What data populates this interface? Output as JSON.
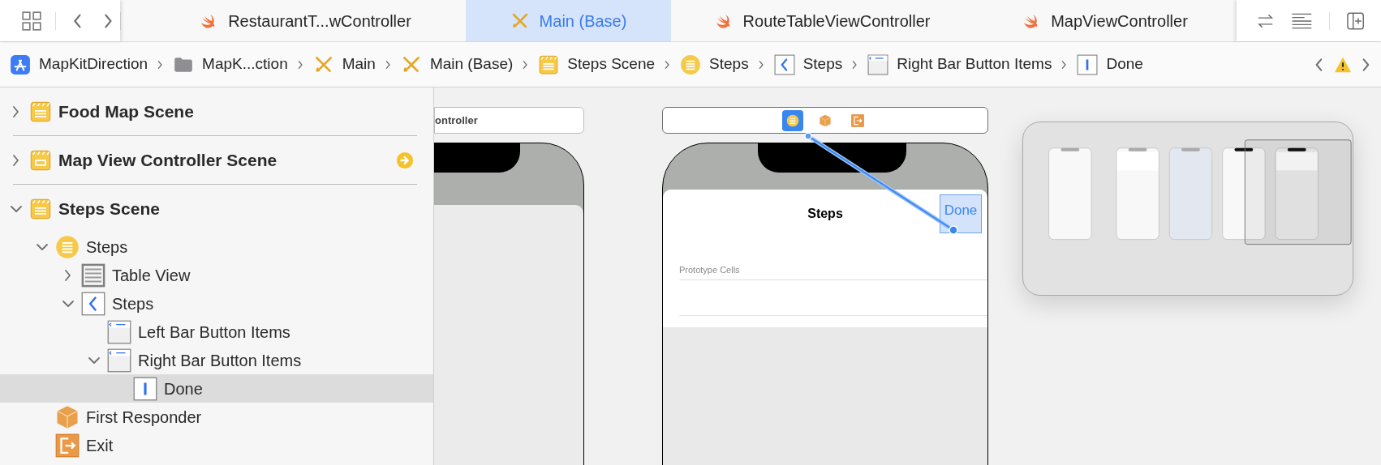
{
  "toolbar": {
    "tabs": [
      {
        "label": "RestaurantT...wController",
        "kind": "swift",
        "selected": false
      },
      {
        "label": "Main (Base)",
        "kind": "storyboard",
        "selected": true
      },
      {
        "label": "RouteTableViewController",
        "kind": "swift",
        "selected": false
      },
      {
        "label": "MapViewController",
        "kind": "swift",
        "selected": false
      }
    ]
  },
  "breadcrumb": [
    {
      "label": "MapKitDirection",
      "kind": "project"
    },
    {
      "label": "MapK...ction",
      "kind": "folder"
    },
    {
      "label": "Main",
      "kind": "storyboard"
    },
    {
      "label": "Main (Base)",
      "kind": "storyboard"
    },
    {
      "label": "Steps Scene",
      "kind": "scene"
    },
    {
      "label": "Steps",
      "kind": "table-controller"
    },
    {
      "label": "Steps",
      "kind": "nav-item"
    },
    {
      "label": "Right Bar Button Items",
      "kind": "bar-items"
    },
    {
      "label": "Done",
      "kind": "bar-button"
    }
  ],
  "outline": [
    {
      "label": "Food Map Scene",
      "kind": "scene",
      "expanded": false,
      "selected": false,
      "entry_point": false
    },
    {
      "label": "Map View Controller Scene",
      "kind": "scene-vc",
      "expanded": false,
      "selected": false,
      "entry_point": true
    },
    {
      "label": "Steps Scene",
      "kind": "scene",
      "expanded": true,
      "selected": false,
      "entry_point": false,
      "children": [
        {
          "label": "Steps",
          "kind": "table-controller",
          "expanded": true,
          "selected": false,
          "children": [
            {
              "label": "Table View",
              "kind": "table-view",
              "expanded": false,
              "selected": false
            },
            {
              "label": "Steps",
              "kind": "nav-item",
              "expanded": true,
              "selected": false,
              "children": [
                {
                  "label": "Left Bar Button Items",
                  "kind": "bar-items",
                  "selected": false
                },
                {
                  "label": "Right Bar Button Items",
                  "kind": "bar-items",
                  "expanded": true,
                  "selected": false,
                  "children": [
                    {
                      "label": "Done",
                      "kind": "bar-button",
                      "selected": true
                    }
                  ]
                }
              ]
            }
          ]
        },
        {
          "label": "First Responder",
          "kind": "first-responder",
          "selected": false
        },
        {
          "label": "Exit",
          "kind": "exit",
          "selected": false
        }
      ]
    }
  ],
  "canvas": {
    "left_scene": {
      "title": "ontroller"
    },
    "right_scene": {
      "dock": [
        {
          "kind": "table-controller",
          "selected": true
        },
        {
          "kind": "first-responder",
          "selected": false
        },
        {
          "kind": "exit",
          "selected": false
        }
      ],
      "nav_title": "Steps",
      "nav_button": "Done",
      "nav_button_selected": true,
      "section_header": "Prototype Cells"
    }
  }
}
